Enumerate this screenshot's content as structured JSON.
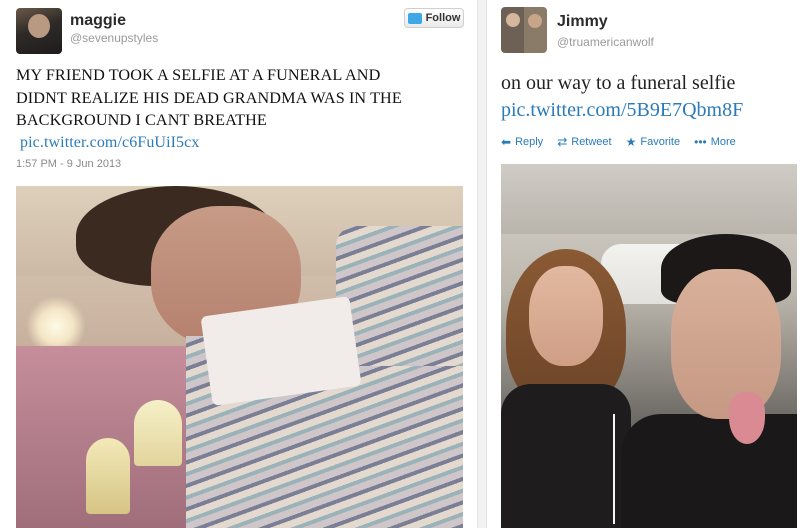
{
  "left_tweet": {
    "name": "maggie",
    "handle": "@sevenupstyles",
    "follow_label": "Follow",
    "text_lines": [
      "MY FRIEND TOOK A SELFIE AT A FUNERAL AND",
      "DIDNT REALIZE HIS DEAD GRANDMA WAS IN THE",
      "BACKGROUND I CANT BREATHE"
    ],
    "link": "pic.twitter.com/c6FuUiI5cx",
    "timestamp": "1:57 PM - 9 Jun 2013"
  },
  "right_tweet": {
    "name": "Jimmy",
    "handle": "@truamericanwolf",
    "text": "on our way to a funeral selfie",
    "link": "pic.twitter.com/5B9E7Qbm8F",
    "actions": {
      "reply": "Reply",
      "retweet": "Retweet",
      "favorite": "Favorite",
      "more": "More"
    }
  },
  "icons": {
    "follow": "bird-icon",
    "reply": "reply-arrow-icon",
    "retweet": "retweet-icon",
    "favorite": "star-icon",
    "more": "ellipsis-icon"
  },
  "colors": {
    "link": "#2b7bb9",
    "follow_bird": "#3ea8e6"
  }
}
